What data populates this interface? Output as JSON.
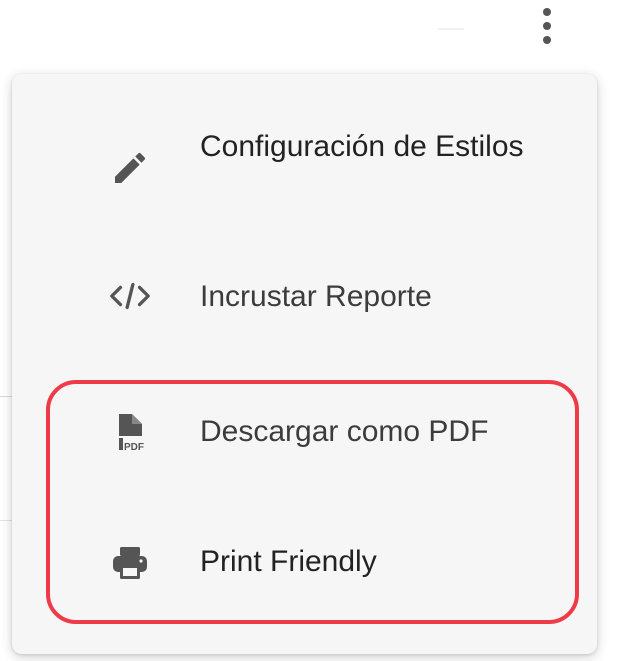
{
  "toolbar": {
    "more_icon": "more-vertical-icon"
  },
  "menu": {
    "items": [
      {
        "label": "Configuración de Estilos",
        "icon": "pencil-icon"
      },
      {
        "label": "Incrustar Reporte",
        "icon": "code-icon"
      },
      {
        "label": "Descargar como PDF",
        "icon": "pdf-file-icon"
      },
      {
        "label": "Print Friendly",
        "icon": "printer-icon"
      }
    ]
  },
  "colors": {
    "menu_background": "#f6f6f6",
    "icon": "#555555",
    "text": "#222222",
    "highlight_border": "#ee3b47"
  }
}
